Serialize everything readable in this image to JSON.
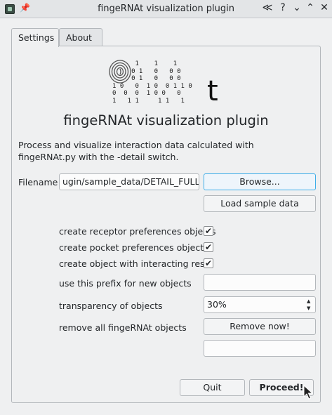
{
  "window": {
    "title": "fingeRNAt visualization plugin",
    "controls": [
      "≪",
      "?",
      "⌄",
      "⌃",
      "✕"
    ]
  },
  "tabs": [
    {
      "label": "Settings",
      "active": true
    },
    {
      "label": "About",
      "active": false
    }
  ],
  "logo": {
    "binary_lines": [
      "      1    1    1",
      "     0 1   0   0 0",
      "     0 1   0   0 0",
      "1 0   0  1 0  0 1 1 0",
      "0  0  0  1 0 0   0",
      "1   1 1     1 1   1"
    ],
    "letter": "t"
  },
  "heading": "fingeRNAt visualization plugin",
  "description": "Process and visualize interaction data calculated with fingeRNAt.py with the -detail switch.",
  "filename": {
    "label": "Filename",
    "value": "ugin/sample_data/DETAIL_FULL.tsv",
    "browse_label": "Browse...",
    "load_sample_label": "Load sample data"
  },
  "options": {
    "receptor_label": "create receptor preferences objects",
    "receptor_checked": true,
    "pocket_label": "create pocket preferences objects",
    "pocket_checked": true,
    "interacting_label": "create object with interacting res.",
    "interacting_checked": true,
    "prefix_label": "use this prefix for new objects",
    "prefix_value": "",
    "transparency_label": "transparency of objects",
    "transparency_value": "30%",
    "remove_label": "remove all fingeRNAt objects",
    "remove_button": "Remove now!",
    "remove_result": ""
  },
  "footer": {
    "quit_label": "Quit",
    "proceed_label": "Proceed!"
  },
  "check_glyph": "✔"
}
